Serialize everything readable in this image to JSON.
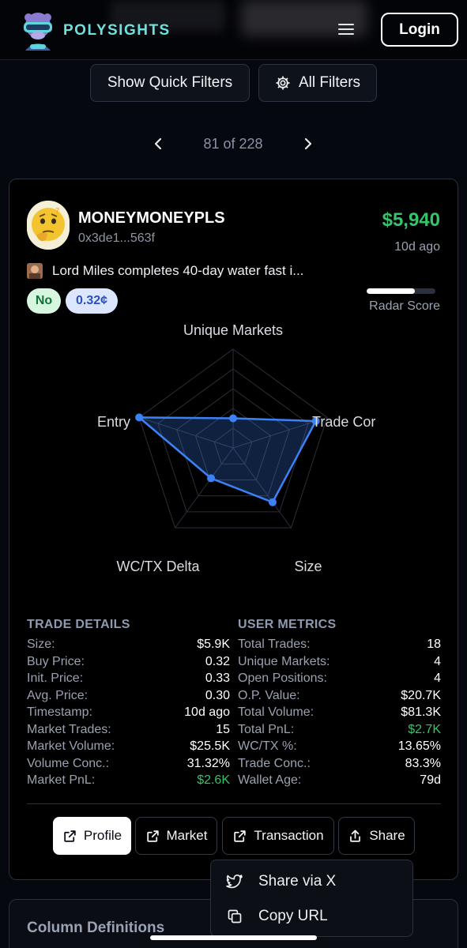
{
  "header": {
    "brand": "POLYSIGHTS",
    "login_label": "Login"
  },
  "filters": {
    "quick_label": "Show Quick Filters",
    "all_label": "All Filters"
  },
  "pager": {
    "current": 81,
    "total": 228,
    "text": "81 of 228"
  },
  "card": {
    "username": "MONEYMONEYPLS",
    "wallet": "0x3de1...563f",
    "amount": "$5,940",
    "time_ago": "10d ago",
    "market_title": "Lord Miles completes 40-day water fast i...",
    "outcome": "No",
    "price": "0.32¢",
    "radar_score_label": "Radar Score",
    "radar_score_fraction": 0.7,
    "radar": {
      "axes": [
        "Unique Markets",
        "Trade Cor",
        "Size",
        "WC/TX Delta",
        "Entry"
      ],
      "values": [
        0.3,
        0.88,
        0.68,
        0.38,
        1.0
      ],
      "color": "#3b82f6"
    },
    "trade_details": {
      "title": "TRADE DETAILS",
      "rows": [
        {
          "label": "Size:",
          "value": "$5.9K"
        },
        {
          "label": "Buy Price:",
          "value": "0.32"
        },
        {
          "label": "Init. Price:",
          "value": "0.33"
        },
        {
          "label": "Avg. Price:",
          "value": "0.30"
        },
        {
          "label": "Timestamp:",
          "value": "10d ago"
        },
        {
          "label": "Market Trades:",
          "value": "15"
        },
        {
          "label": "Market Volume:",
          "value": "$25.5K"
        },
        {
          "label": "Volume Conc.:",
          "value": "31.32%"
        },
        {
          "label": "Market PnL:",
          "value": "$2.6K"
        }
      ]
    },
    "user_metrics": {
      "title": "USER METRICS",
      "rows": [
        {
          "label": "Total Trades:",
          "value": "18"
        },
        {
          "label": "Unique Markets:",
          "value": "4"
        },
        {
          "label": "Open Positions:",
          "value": "4"
        },
        {
          "label": "O.P. Value:",
          "value": "$20.7K"
        },
        {
          "label": "Total Volume:",
          "value": "$81.3K"
        },
        {
          "label": "Total PnL:",
          "value": "$2.7K"
        },
        {
          "label": "WC/TX %:",
          "value": "13.65%"
        },
        {
          "label": "Trade Conc.:",
          "value": "83.3%"
        },
        {
          "label": "Wallet Age:",
          "value": "79d"
        }
      ]
    },
    "actions": {
      "profile": "Profile",
      "market": "Market",
      "transaction": "Transaction",
      "share": "Share"
    }
  },
  "share_menu": {
    "share_x": "Share via X",
    "copy_url": "Copy URL"
  },
  "column_definitions": {
    "title": "Column Definitions"
  },
  "colors": {
    "positive": "#34c46a",
    "brand": "#6fe1dd",
    "accent": "#3b82f6"
  }
}
